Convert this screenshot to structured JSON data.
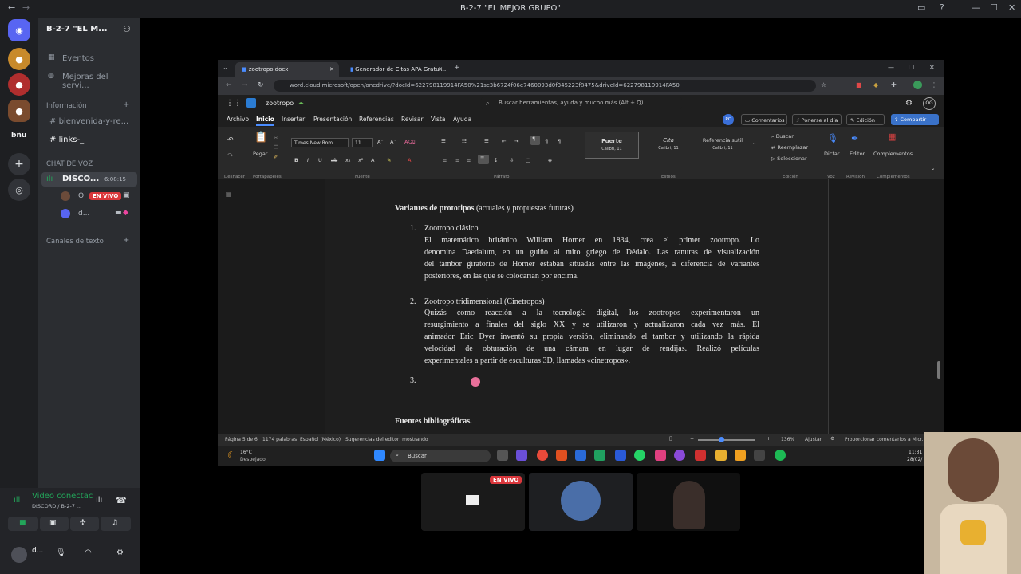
{
  "window": {
    "title": "B-2-7 \"EL MEJOR GRUPO\""
  },
  "server": {
    "name": "B-2-7 \"EL M...",
    "channels": {
      "events": "Eventos",
      "improvements": "Mejoras del servi...",
      "info_category": "Información",
      "welcome": "bienvenida-y-re...",
      "links": "links-_",
      "voice_category": "CHAT DE VOZ",
      "voice_channel": "DISCO...",
      "voice_timer": "6:08:15",
      "member_1": "O",
      "member_2": "d...",
      "text_category": "Canales de texto"
    },
    "rail_label": "bñu"
  },
  "live_badge": "EN VIVO",
  "voice_panel": {
    "status": "Video conectac",
    "subtitle": "DISCORD / B-2-7 ...",
    "user": "d..."
  },
  "browser": {
    "tab1": "zootropo.docx",
    "tab2": "Generador de Citas APA Gratui...",
    "url": "word.cloud.microsoft/open/onedrive/?docId=622798119914FA50%21sc3b6724f06e7460093d0f345223f8475&driveId=622798119914FA50"
  },
  "word": {
    "doc_name": "zootropo",
    "search_placeholder": "Buscar herramientas, ayuda y mucho más (Alt + Q)",
    "avatar": "OG",
    "menus": [
      "Archivo",
      "Inicio",
      "Insertar",
      "Presentación",
      "Referencias",
      "Revisar",
      "Vista",
      "Ayuda"
    ],
    "buttons": {
      "comments": "Comentarios",
      "catch_up": "Ponerse al día",
      "editing": "Edición",
      "share": "Compartir"
    },
    "ribbon": {
      "undo": "Deshacer",
      "paste": "Pegar",
      "clipboard": "Portapapeles",
      "font_name": "Times New Rom...",
      "font_size": "11",
      "font_group": "Fuente",
      "paragraph_group": "Párrafo",
      "styles_group": "Estilos",
      "style1_title": "Fuerte",
      "style1_sub": "Calibri, 11",
      "style2_title": "Cita",
      "style2_sub": "Calibri, 11",
      "style3_title": "Referencia sutil",
      "style3_sub": "Calibri, 11",
      "find": "Buscar",
      "replace": "Reemplazar",
      "select": "Seleccionar",
      "editing_group": "Edición",
      "dictate": "Dictar",
      "voice_group": "Voz",
      "editor": "Editor",
      "review_group": "Revisión",
      "addins": "Complementos",
      "addins_group": "Complementos"
    },
    "document": {
      "heading_bold": "Variantes de prototipos",
      "heading_rest": " (actuales y propuestas futuras)",
      "item1_num": "1.",
      "item1_title": "Zootropo clásico",
      "item1_lines": [
        "El matemático británico William Horner en 1834, crea el primer zootropo. Lo",
        "denomina Daedalum, en un guiño al mito griego de Dédalo. Las ranuras de visualización",
        "del tambor giratorio de Horner estaban situadas entre las imágenes, a diferencia de variantes"
      ],
      "item1_last": "posteriores, en las que se colocarían por encima.",
      "item2_num": "2.",
      "item2_title": "Zootropo tridimensional (Cinetropos)",
      "item2_lines": [
        "Quizás como reacción a la tecnología digital, los zootropos experimentaron un",
        "resurgimiento a finales del siglo XX y se utilizaron y actualizaron cada vez más. El",
        "animador Eric Dyer inventó su propia versión, eliminando el tambor y utilizando la rápida",
        "velocidad de obturación de una cámara en lugar de rendijas. Realizó películas"
      ],
      "item2_last": "experimentales a partir de esculturas 3D, llamadas «cinetropos».",
      "item3_num": "3.",
      "sources": "Fuentes bibliográficas."
    },
    "status": {
      "page": "Página 5 de 6",
      "words": "1174 palabras",
      "language": "Español (México)",
      "suggestions": "Sugerencias del editor: mostrando",
      "zoom": "136%",
      "fit": "Ajustar",
      "feedback": "Proporcionar comentarios a Micr..."
    }
  },
  "taskbar": {
    "temp": "16°C",
    "weather": "Despejado",
    "search": "Buscar",
    "time": "11:31 p",
    "date": "28/02/"
  }
}
